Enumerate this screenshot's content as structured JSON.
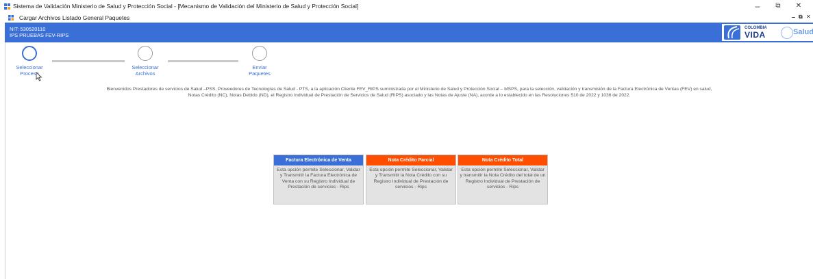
{
  "window": {
    "title": "Sistema de Validación Ministerio de Salud y Protección Social - [Mecanismo de Validación del Ministerio de Salud y Protección Social]",
    "minimize": "–",
    "maximize": "⧉",
    "close": "✕"
  },
  "menubar": {
    "items": [
      "Cargar Archivos",
      "Listado General Paquetes"
    ],
    "mdi_minimize": "–",
    "mdi_restore": "⧉",
    "mdi_close": "✕"
  },
  "header": {
    "nit": "NIT: 530520110",
    "ips": "IPS PRUEBAS FEV-RIPS",
    "logo_colombia": "COLOMBIA",
    "logo_vida": "VIDA",
    "logo_salud": "Salud",
    "color": "#3a6fd8"
  },
  "stepper": {
    "steps": [
      {
        "line1": "Seleccionar",
        "line2": "Proceso",
        "active": true
      },
      {
        "line1": "Seleccionar",
        "line2": "Archivos",
        "active": false
      },
      {
        "line1": "Enviar",
        "line2": "Paquetes",
        "active": false
      }
    ]
  },
  "intro": {
    "text": "Bienvenidos Prestadores de servicios de Salud –PSS, Proveedores de Tecnologías de Salud - PTS,  a la aplicación Cliente FEV_RIPS suministrada por el Ministerio de Salud y Protección Social – MSPS,  para la selección, validación y transmisión de la Factura Electrónica de Ventas (FEV) en salud, Notas Crédito (NC), Notas Debido (ND), el Registro Individual de Prestación de Servicios de Salud (RIPS) asociado y las Notas de Ajuste (NA), acorde a lo establecido en las Resoluciones 510 de 2022 y 1036 de 2022."
  },
  "options": [
    {
      "title": "Factura Electrónica de Venta",
      "description": "Esta opción permite Seleccionar, Validar y Transmitir la Factura Electrónica de Venta con su Registro Individual de Prestación de servicios - Rips",
      "color": "#3a6fd8"
    },
    {
      "title": "Nota Crédito Parcial",
      "description": "Esta opción permite Seleccionar, Validar y Transmitir la Nota Crédito con su Registro Individual de Prestación de servicios - Rips",
      "color": "#ff4e00"
    },
    {
      "title": "Nota Crédito Total",
      "description": "Esta opción permite Seleccionar, Validar y transmitir la Nota Crédito del total de un Registro Individual de Prestación de servicios - Rips",
      "color": "#ff4e00"
    }
  ]
}
